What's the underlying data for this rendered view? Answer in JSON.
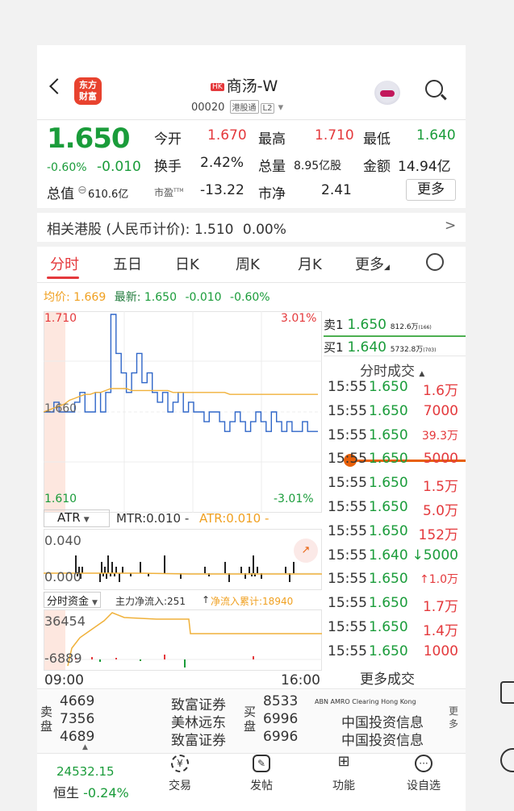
{
  "header": {
    "logo_text": "东方\n财富",
    "hk_badge": "HK",
    "stock_name": "商汤-W",
    "stock_code": "00020",
    "tag_connect": "港股通",
    "tag_level": "L2",
    "dropdown_arrow": "▾"
  },
  "quote": {
    "price": "1.650",
    "change_pct": "-0.60%",
    "change_abs": "-0.010",
    "open_label": "今开",
    "open": "1.670",
    "high_label": "最高",
    "high": "1.710",
    "low_label": "最低",
    "low": "1.640",
    "turnover_label": "换手",
    "turnover": "2.42%",
    "volume_label": "总量",
    "volume": "8.95亿股",
    "amount_label": "金额",
    "amount": "14.94亿",
    "mktcap_label": "总值",
    "mktcap_icon": "⊖",
    "mktcap": "610.6亿",
    "pe_label": "市盈",
    "pe_sup": "TTM",
    "pe": "-13.22",
    "pb_label": "市净",
    "pb": "2.41",
    "more_label": "更多"
  },
  "related": {
    "label": "相关港股 (人民币计价):",
    "price": "1.510",
    "pct": "0.00%",
    "arrow": ">"
  },
  "tabs": [
    "分时",
    "五日",
    "日K",
    "周K",
    "月K",
    "更多"
  ],
  "chart_info": {
    "avg_label": "均价:",
    "avg": "1.669",
    "latest_label": "最新:",
    "latest": "1.650",
    "chg": "-0.010",
    "pct": "-0.60%"
  },
  "chart_data": {
    "type": "line",
    "y_max": 1.71,
    "y_min": 1.61,
    "y_ref": 1.66,
    "top_pct": "3.01%",
    "bottom_pct": "-3.01%",
    "y_max_label": "1.710",
    "y_min_label": "1.610",
    "y_ref_label": "1.660",
    "x_start": "09:00",
    "x_end": "16:00",
    "series": [
      {
        "values": [
          1.66,
          1.66,
          1.665,
          1.66,
          1.66,
          1.66,
          1.665,
          1.67,
          1.66,
          1.66,
          1.67,
          1.66,
          1.67,
          1.71,
          1.69,
          1.68,
          1.67,
          1.68,
          1.69,
          1.675,
          1.68,
          1.67,
          1.665,
          1.67,
          1.66,
          1.665,
          1.67,
          1.66,
          1.665,
          1.66,
          1.66,
          1.655,
          1.66,
          1.66,
          1.655,
          1.65,
          1.655,
          1.66,
          1.655,
          1.65,
          1.655,
          1.66,
          1.655,
          1.65,
          1.66,
          1.655,
          1.65,
          1.655,
          1.65,
          1.65,
          1.655,
          1.65,
          1.65,
          1.65
        ]
      },
      {
        "values": [
          1.66,
          1.661,
          1.662,
          1.663,
          1.664,
          1.666,
          1.667,
          1.668,
          1.669,
          1.669,
          1.67,
          1.67,
          1.671,
          1.672,
          1.672,
          1.672,
          1.672,
          1.671,
          1.671,
          1.671,
          1.671,
          1.671,
          1.671,
          1.671,
          1.671,
          1.67,
          1.67,
          1.67,
          1.67,
          1.67,
          1.67,
          1.67,
          1.67,
          1.67,
          1.67,
          1.67,
          1.669,
          1.669,
          1.669,
          1.669,
          1.669,
          1.669,
          1.669,
          1.669,
          1.669,
          1.669,
          1.669,
          1.669,
          1.669,
          1.669,
          1.669,
          1.669,
          1.669,
          1.669
        ]
      }
    ]
  },
  "orderbook": {
    "ask_label": "卖1",
    "ask_price": "1.650",
    "ask_vol": "812.6万",
    "ask_cnt": "(166)",
    "bid_label": "买1",
    "bid_price": "1.640",
    "bid_vol": "5732.8万",
    "bid_cnt": "(703)"
  },
  "trades": {
    "header": "分时成交",
    "header_icon": "▲",
    "rows": [
      {
        "time": "15:55",
        "price": "1.650",
        "vol": "1.6万",
        "dir": ""
      },
      {
        "time": "15:55",
        "price": "1.650",
        "vol": "7000",
        "dir": ""
      },
      {
        "time": "15:55",
        "price": "1.650",
        "vol": "39.3万",
        "dir": ""
      },
      {
        "time": "15:55",
        "price": "1.650",
        "vol": "5000",
        "dir": ""
      },
      {
        "time": "15:55",
        "price": "1.650",
        "vol": "1.5万",
        "dir": ""
      },
      {
        "time": "15:55",
        "price": "1.650",
        "vol": "5.0万",
        "dir": ""
      },
      {
        "time": "15:55",
        "price": "1.650",
        "vol": "152万",
        "dir": ""
      },
      {
        "time": "15:55",
        "price": "1.640",
        "vol": "↓5000",
        "dir": "down"
      },
      {
        "time": "15:55",
        "price": "1.650",
        "vol": "↑1.0万",
        "dir": "up"
      },
      {
        "time": "15:55",
        "price": "1.650",
        "vol": "1.7万",
        "dir": ""
      },
      {
        "time": "15:55",
        "price": "1.650",
        "vol": "1.4万",
        "dir": ""
      },
      {
        "time": "15:55",
        "price": "1.650",
        "vol": "1000",
        "dir": ""
      }
    ],
    "more": "更多成交"
  },
  "atr": {
    "selector": "ATR",
    "mtr": "MTR:0.010 -",
    "atr_val": "ATR:0.010 -",
    "top": "0.040",
    "bottom": "0.000"
  },
  "capital": {
    "selector": "分时资金",
    "main_inflow": "主力净流入:251",
    "up_arrow": "↑",
    "cum_inflow": "净流入累计:18940",
    "top": "36454",
    "bottom": "-6889"
  },
  "broker": {
    "sell_label": "卖\n盘",
    "buy_label": "买\n盘",
    "more_label": "更\n多",
    "sell": [
      {
        "vol": "4669",
        "name": "致富证券"
      },
      {
        "vol": "7356",
        "name": "美林远东"
      },
      {
        "vol": "4689",
        "name": "致富证券"
      }
    ],
    "buy": [
      {
        "vol": "8533",
        "name": "ABN AMRO Clearing Hong Kong"
      },
      {
        "vol": "6996",
        "name": "中国投资信息"
      },
      {
        "vol": "6996",
        "name": "中国投资信息"
      }
    ]
  },
  "bottom_nav": {
    "index_value": "24532.15",
    "index_name": "恒生",
    "index_pct": "-0.24%",
    "items": [
      "交易",
      "发帖",
      "功能",
      "设自选"
    ]
  }
}
